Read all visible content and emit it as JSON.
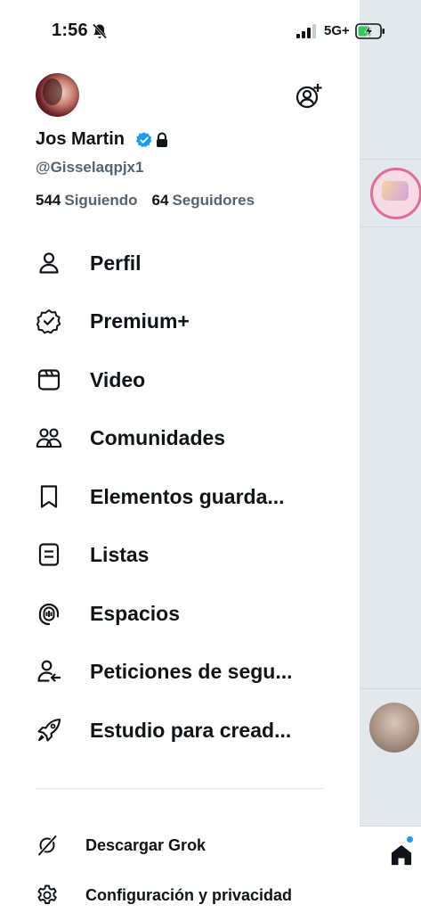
{
  "status_bar": {
    "time": "1:56",
    "network": "5G+",
    "icons": [
      "bell-off-icon",
      "signal-bars-icon",
      "battery-charging-icon"
    ]
  },
  "profile": {
    "display_name": "Jos Martin",
    "handle": "@Gisselaqpjx1",
    "following_count": "544",
    "following_label": "Siguiendo",
    "followers_count": "64",
    "followers_label": "Seguidores",
    "badges": [
      "verified-badge-icon",
      "lock-icon"
    ]
  },
  "menu": {
    "items": [
      {
        "label": "Perfil",
        "icon": "person-icon"
      },
      {
        "label": "Premium+",
        "icon": "premium-badge-icon"
      },
      {
        "label": "Video",
        "icon": "video-icon"
      },
      {
        "label": "Comunidades",
        "icon": "communities-icon"
      },
      {
        "label": "Elementos guarda...",
        "icon": "bookmark-icon"
      },
      {
        "label": "Listas",
        "icon": "list-icon"
      },
      {
        "label": "Espacios",
        "icon": "spaces-icon"
      },
      {
        "label": "Peticiones de segu...",
        "icon": "follow-request-icon"
      },
      {
        "label": "Estudio para cread...",
        "icon": "rocket-icon"
      }
    ]
  },
  "secondary": {
    "items": [
      {
        "label": "Descargar Grok",
        "icon": "grok-icon"
      },
      {
        "label": "Configuración y privacidad",
        "icon": "gear-icon"
      }
    ]
  },
  "colors": {
    "text": "#0f1419",
    "muted": "#536471",
    "accent": "#1d9bf0",
    "backdrop": "#e3e8ed"
  }
}
